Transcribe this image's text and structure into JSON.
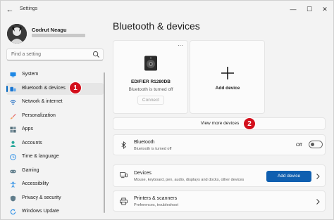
{
  "window": {
    "title": "Settings",
    "back_glyph": "←",
    "minimize_glyph": "—",
    "maximize_glyph": "☐",
    "close_glyph": "✕"
  },
  "user": {
    "name": "Codrut Neagu"
  },
  "search": {
    "placeholder": "Find a setting",
    "icon": "search-icon"
  },
  "sidebar": {
    "items": [
      {
        "label": "System",
        "icon": "system-icon",
        "color": "#1e88e5"
      },
      {
        "label": "Bluetooth & devices",
        "icon": "bluetooth-icon",
        "color": "#1976d2",
        "active": true
      },
      {
        "label": "Network & internet",
        "icon": "wifi-icon",
        "color": "#1565c0"
      },
      {
        "label": "Personalization",
        "icon": "brush-icon",
        "color": "#e57373"
      },
      {
        "label": "Apps",
        "icon": "apps-icon",
        "color": "#546e7a"
      },
      {
        "label": "Accounts",
        "icon": "accounts-icon",
        "color": "#26a69a"
      },
      {
        "label": "Time & language",
        "icon": "globe-clock-icon",
        "color": "#1e88e5"
      },
      {
        "label": "Gaming",
        "icon": "gamepad-icon",
        "color": "#607d8b"
      },
      {
        "label": "Accessibility",
        "icon": "accessibility-icon",
        "color": "#1e88e5"
      },
      {
        "label": "Privacy & security",
        "icon": "shield-icon",
        "color": "#607d8b"
      },
      {
        "label": "Windows Update",
        "icon": "update-icon",
        "color": "#1e88e5"
      }
    ]
  },
  "annotations": {
    "badge_1": "1",
    "badge_2": "2",
    "badge_color": "#d30f1c"
  },
  "main": {
    "title": "Bluetooth & devices",
    "device_card": {
      "more_glyph": "···",
      "name": "EDIFIER R1280DB",
      "status": "Bluetooth is turned off",
      "button": "Connect"
    },
    "add_card": {
      "label": "Add device"
    },
    "view_more": "View more devices",
    "bluetooth_row": {
      "title": "Bluetooth",
      "subtitle": "Bluetooth is turned off",
      "toggle_label": "Off",
      "toggle_on": false
    },
    "devices_row": {
      "title": "Devices",
      "subtitle": "Mouse, keyboard, pen, audio, displays and docks, other devices",
      "button": "Add device"
    },
    "printers_row": {
      "title": "Printers & scanners",
      "subtitle": "Preferences, troubleshoot"
    }
  },
  "colors": {
    "accent": "#0067c0",
    "primary_button": "#0f5fb0"
  }
}
